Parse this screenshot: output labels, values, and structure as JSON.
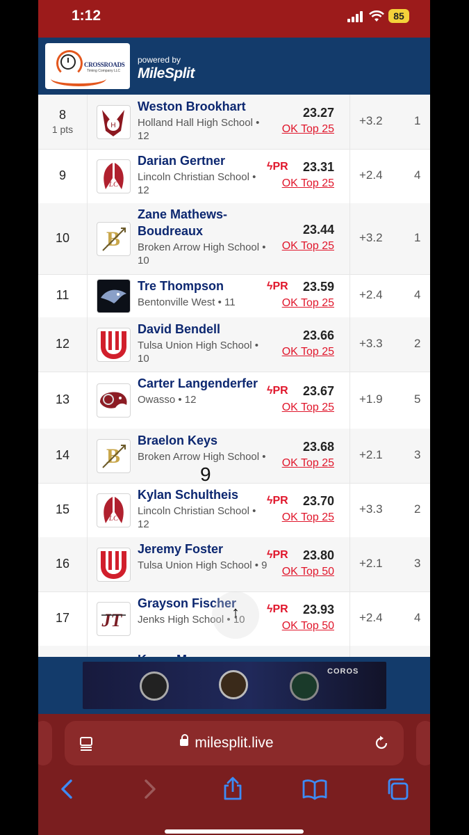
{
  "status_bar": {
    "time": "1:12",
    "battery": "85"
  },
  "header": {
    "logo_name": "CROSSROADS",
    "logo_sub": "Timing Company LLC",
    "powered_by": "powered by",
    "brand": "MileSplit"
  },
  "results": [
    {
      "place": "8",
      "points": "1 pts",
      "athlete": "Weston Brookhart",
      "school": "Holland Hall High School • 12",
      "pr": "",
      "mark": "23.27",
      "rank": "OK Top 25",
      "wind": "+3.2",
      "heat": "1"
    },
    {
      "place": "9",
      "points": "",
      "athlete": "Darian Gertner",
      "school": "Lincoln Christian School • 12",
      "pr": "PR",
      "mark": "23.31",
      "rank": "OK Top 25",
      "wind": "+2.4",
      "heat": "4"
    },
    {
      "place": "10",
      "points": "",
      "athlete": "Zane Mathews-Boudreaux",
      "school": "Broken Arrow High School • 10",
      "pr": "",
      "mark": "23.44",
      "rank": "OK Top 25",
      "wind": "+3.2",
      "heat": "1"
    },
    {
      "place": "11",
      "points": "",
      "athlete": "Tre Thompson",
      "school": "Bentonville West • 11",
      "pr": "PR",
      "mark": "23.59",
      "rank": "OK Top 25",
      "wind": "+2.4",
      "heat": "4"
    },
    {
      "place": "12",
      "points": "",
      "athlete": "David Bendell",
      "school": "Tulsa Union High School • 10",
      "pr": "",
      "mark": "23.66",
      "rank": "OK Top 25",
      "wind": "+3.3",
      "heat": "2"
    },
    {
      "place": "13",
      "points": "",
      "athlete": "Carter Langenderfer",
      "school": "Owasso • 12",
      "pr": "PR",
      "mark": "23.67",
      "rank": "OK Top 25",
      "wind": "+1.9",
      "heat": "5"
    },
    {
      "place": "14",
      "points": "",
      "athlete": "Braelon Keys",
      "school": "Broken Arrow High School •",
      "pr": "",
      "mark": "23.68",
      "rank": "OK Top 25",
      "wind": "+2.1",
      "heat": "3"
    },
    {
      "place": "15",
      "points": "",
      "athlete": "Kylan Schultheis",
      "school": "Lincoln Christian School • 12",
      "pr": "PR",
      "mark": "23.70",
      "rank": "OK Top 25",
      "wind": "+3.3",
      "heat": "2"
    },
    {
      "place": "16",
      "points": "",
      "athlete": "Jeremy Foster",
      "school": "Tulsa Union High School • 9",
      "pr": "PR",
      "mark": "23.80",
      "rank": "OK Top 50",
      "wind": "+2.1",
      "heat": "3"
    },
    {
      "place": "17",
      "points": "",
      "athlete": "Grayson Fischer",
      "school": "Jenks High School • 10",
      "pr": "PR",
      "mark": "23.93",
      "rank": "OK Top 50",
      "wind": "+2.4",
      "heat": "4"
    },
    {
      "place": "",
      "points": "",
      "athlete": "Kyren Myers",
      "school": "",
      "pr": "",
      "mark": "",
      "rank": "",
      "wind": "",
      "heat": ""
    }
  ],
  "overlay": {
    "touch_digit": "9",
    "scroll_up": "↑"
  },
  "ad": {
    "brand": "COROS"
  },
  "browser": {
    "url": "milesplit.live"
  }
}
